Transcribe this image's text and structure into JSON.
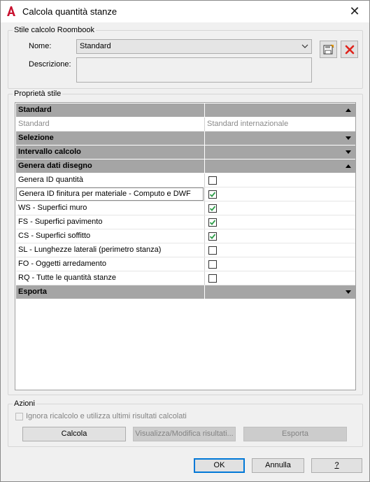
{
  "window": {
    "title": "Calcola quantità stanze",
    "close_glyph": "✕",
    "app_icon": "autocad-a-icon",
    "accent": "#c8102e"
  },
  "style_group": {
    "legend": "Stile calcolo Roombook",
    "name_label": "Nome:",
    "name_value": "Standard",
    "description_label": "Descrizione:",
    "description_value": "",
    "save_icon": "save-style-icon",
    "delete_icon": "delete-style-icon"
  },
  "properties_group": {
    "legend": "Proprietà stile",
    "rows": [
      {
        "type": "category",
        "label": "Standard",
        "expanded": true
      },
      {
        "type": "readonly",
        "label": "Standard",
        "value": "Standard internazionale"
      },
      {
        "type": "category",
        "label": "Selezione",
        "expanded": false
      },
      {
        "type": "category",
        "label": "Intervallo calcolo",
        "expanded": false
      },
      {
        "type": "category",
        "label": "Genera dati disegno",
        "expanded": true
      },
      {
        "type": "check",
        "label": "Genera ID quantità",
        "checked": false
      },
      {
        "type": "check",
        "label": "Genera ID finitura per materiale - Computo e DWF",
        "checked": true,
        "selected": true
      },
      {
        "type": "check",
        "label": "WS - Superfici muro",
        "checked": true
      },
      {
        "type": "check",
        "label": "FS - Superfici pavimento",
        "checked": true
      },
      {
        "type": "check",
        "label": "CS - Superfici soffitto",
        "checked": true
      },
      {
        "type": "check",
        "label": "SL - Lunghezze laterali (perimetro stanza)",
        "checked": false
      },
      {
        "type": "check",
        "label": "FO - Oggetti arredamento",
        "checked": false
      },
      {
        "type": "check",
        "label": "RQ - Tutte le quantità stanze",
        "checked": false
      },
      {
        "type": "category",
        "label": "Esporta",
        "expanded": false
      }
    ]
  },
  "actions_group": {
    "legend": "Azioni",
    "ignore_label": "Ignora ricalcolo e utilizza ultimi risultati calcolati",
    "ignore_checked": false,
    "calc_button": "Calcola",
    "view_button": "Visualizza/Modifica risultati...",
    "export_button": "Esporta"
  },
  "footer": {
    "ok": "OK",
    "cancel": "Annulla",
    "help": "?"
  },
  "colors": {
    "check_green": "#2e9e4a",
    "category_bg": "#a5a5a5",
    "delete_red": "#e0231b"
  }
}
